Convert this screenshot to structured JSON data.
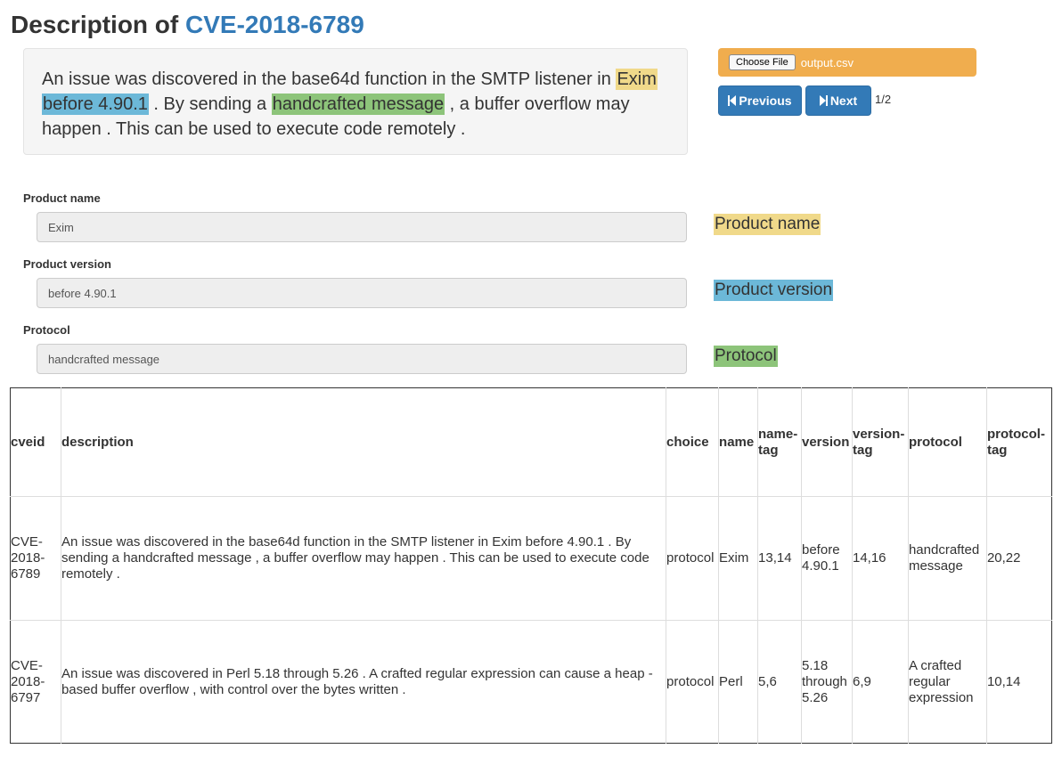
{
  "header": {
    "title_prefix": "Description of",
    "cve_id": "CVE-2018-6789"
  },
  "description": {
    "part1": "An issue was discovered in the base64d function in the SMTP listener in ",
    "product_name": "Exim",
    "gap1": " ",
    "product_version": "before 4.90.1",
    "part2": " . By sending a ",
    "protocol": "handcrafted message",
    "part3": " , a buffer overflow may happen . This can be used to execute code remotely ."
  },
  "file": {
    "button_label": "Choose File",
    "file_name": "output.csv"
  },
  "pagination": {
    "previous_label": "Previous",
    "next_label": "Next",
    "page_indicator": "1/2"
  },
  "fields": {
    "product_name": {
      "label": "Product name",
      "value": "Exim",
      "tag": "Product name"
    },
    "product_version": {
      "label": "Product version",
      "value": "before 4.90.1",
      "tag": "Product version"
    },
    "protocol": {
      "label": "Protocol",
      "value": "handcrafted message",
      "tag": "Protocol"
    }
  },
  "colors": {
    "name_highlight": "#f0d98a",
    "version_highlight": "#6cb8d8",
    "protocol_highlight": "#8dc47a",
    "file_bar": "#f0ad4e",
    "primary_button": "#337ab7",
    "link": "#337ab7"
  },
  "table": {
    "headers": [
      "cveid",
      "description",
      "choice",
      "name",
      "name-tag",
      "version",
      "version-tag",
      "protocol",
      "protocol-tag"
    ],
    "rows": [
      [
        "CVE-2018-6789",
        "An issue was discovered in the base64d function in the SMTP listener in Exim before 4.90.1 . By sending a handcrafted message , a buffer overflow may happen . This can be used to execute code remotely .",
        "protocol",
        "Exim",
        "13,14",
        "before 4.90.1",
        "14,16",
        "handcrafted message",
        "20,22"
      ],
      [
        "CVE-2018-6797",
        "An issue was discovered in Perl 5.18 through 5.26 . A crafted regular expression can cause a heap - based buffer overflow , with control over the bytes written .",
        "protocol",
        "Perl",
        "5,6",
        "5.18 through 5.26",
        "6,9",
        "A crafted regular expression",
        "10,14"
      ]
    ]
  }
}
